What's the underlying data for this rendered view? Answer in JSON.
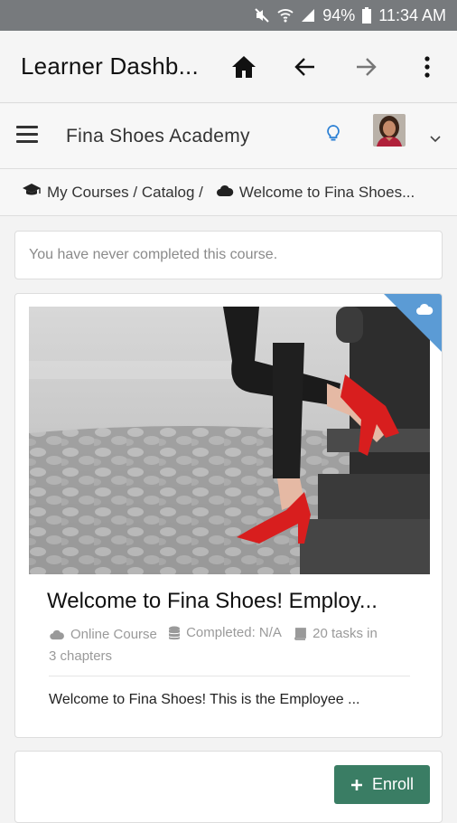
{
  "status_bar": {
    "battery": "94%",
    "time": "11:34 AM"
  },
  "app_bar": {
    "title": "Learner Dashb..."
  },
  "header": {
    "site_name": "Fina Shoes Academy"
  },
  "breadcrumb": {
    "path": "My Courses / Catalog /",
    "current": "Welcome to Fina Shoes..."
  },
  "notice": {
    "text": "You have never completed this course."
  },
  "course": {
    "title": "Welcome to Fina Shoes! Employ...",
    "type": "Online Course",
    "completed": "Completed: N/A",
    "tasks_line1": "20 tasks in",
    "tasks_line2": "3 chapters",
    "description": "Welcome to Fina Shoes! This is the Employee ..."
  },
  "enroll": {
    "label": "Enroll"
  },
  "colors": {
    "accent": "#3a7d64",
    "ribbon": "#5b9bd5",
    "status_bar": "#777a7d"
  }
}
